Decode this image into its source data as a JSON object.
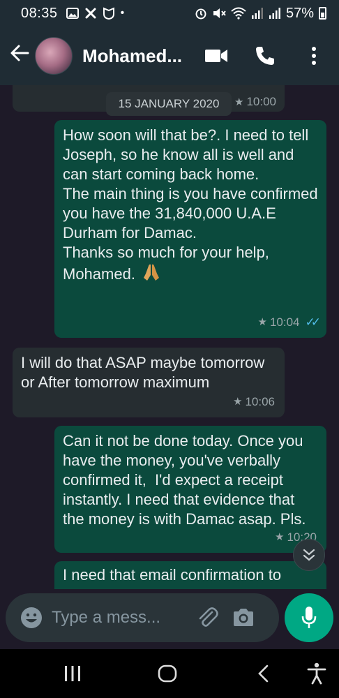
{
  "status_bar": {
    "time": "08:35",
    "battery": "57%",
    "dot": "•"
  },
  "header": {
    "contact_name": "Mohamed...",
    "icons": [
      "back-arrow-icon",
      "video-call-icon",
      "phone-icon",
      "more-vert-icon"
    ]
  },
  "chat": {
    "date_chip": "15 JANUARY 2020",
    "top_time": "10:00",
    "messages": [
      {
        "direction": "outgoing",
        "text": "How soon will that be?. I need to tell Joseph, so he know all is well and can start coming back home.\nThe main thing is you have confirmed you have the 31,840,000 U.A.E Durham for Damac.\nThanks so much for your help, Mohamed.",
        "emoji": "folded-hands-icon",
        "time": "10:04",
        "starred": true,
        "read": true
      },
      {
        "direction": "incoming",
        "text": "I will do that ASAP maybe tomorrow or After tomorrow maximum",
        "time": "10:06",
        "starred": true
      },
      {
        "direction": "outgoing",
        "text": "Can it not be done today. Once you have the money, you've verbally confirmed it,  I'd expect a receipt instantly. I need that evidence that the money is with Damac asap. Pls.",
        "time": "10:20",
        "starred": true
      },
      {
        "direction": "outgoing",
        "text": "I need that email confirmation to"
      }
    ]
  },
  "composer": {
    "placeholder": "Type a mess..."
  },
  "colors": {
    "header_bg": "#1f2c34",
    "chat_bg": "#1e1a28",
    "outgoing_bubble": "#0b4a3d",
    "incoming_bubble": "#262d31",
    "accent": "#00a884",
    "read_ticks": "#53bdeb"
  }
}
